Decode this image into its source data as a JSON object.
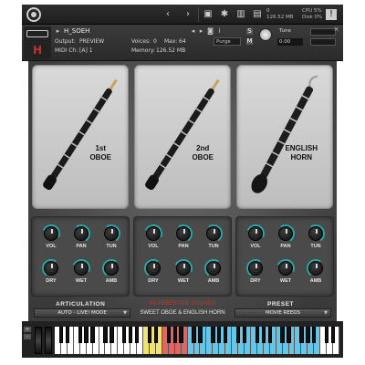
{
  "topbar": {
    "icons": [
      "kontakt-logo-icon",
      "chevron-left-icon",
      "chevron-right-icon",
      "save-icon",
      "gear-icon",
      "keyboard-icon",
      "browser-icon"
    ],
    "cpu": "CPU  5%",
    "disk": "Disk 0%",
    "voices": "0",
    "memory": "126.52 MB"
  },
  "header": {
    "instrument_name": "H_SOEH",
    "output_label": "Output:",
    "output_value": "PREVIEW",
    "midi_label": "MIDI Ch:",
    "midi_value": "[A]  1",
    "voices_label": "Voices:",
    "voices_value": "0",
    "max_label": "Max:",
    "max_value": "64",
    "memory_label": "Memory:",
    "memory_value": "126.52 MB",
    "purge_label": "Purge",
    "tune_label": "Tune",
    "tune_value": "0.00",
    "solo_label": "S",
    "mute_label": "M"
  },
  "instruments": [
    {
      "line1": "1st",
      "line2": "OBOE"
    },
    {
      "line1": "2nd",
      "line2": "OBOE"
    },
    {
      "line1": "ENGLISH",
      "line2": "HORN"
    }
  ],
  "knob_labels": [
    "VOL",
    "PAN",
    "TUN",
    "DRY",
    "WET",
    "AMB"
  ],
  "bottom": {
    "articulation_title": "ARTICULATION",
    "articulation_value": "AUTO - LIVE! MODE",
    "brand": "HEARBESTER SOUNDS",
    "product": "SWEET OBOE & ENGLISH HORN",
    "preset_title": "PRESET",
    "preset_value": "MOVIE REEDS"
  },
  "keyboard": {
    "buttons": [
      "+",
      "-"
    ],
    "accent_yellow": "#f1e36b",
    "accent_red": "#e06666",
    "accent_blue": "#66c6e8"
  },
  "colors": {
    "knob_ring": "#2aa7a7",
    "brand_red": "#c0392b"
  }
}
